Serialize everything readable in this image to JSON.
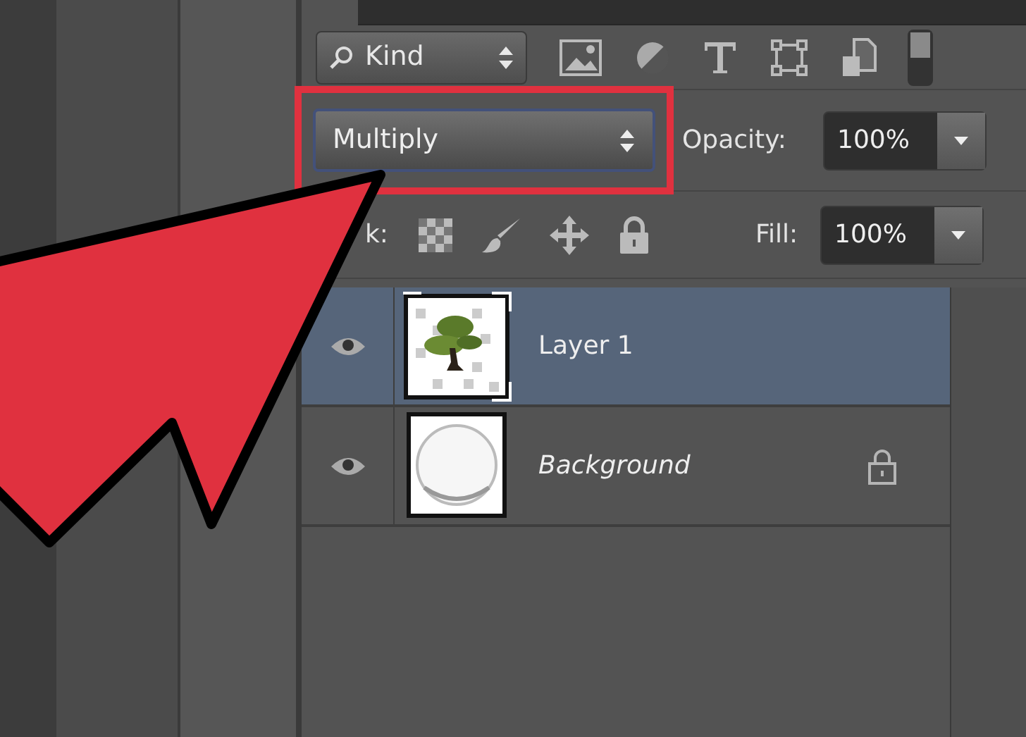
{
  "filter": {
    "label": "Kind"
  },
  "blend_mode": {
    "value": "Multiply",
    "highlighted": true
  },
  "opacity": {
    "label": "Opacity:",
    "value": "100%"
  },
  "lock": {
    "label": "k:"
  },
  "fill": {
    "label": "Fill:",
    "value": "100%"
  },
  "layers": [
    {
      "name": "Layer 1",
      "kind": "normal",
      "selected": true,
      "visible": true,
      "locked": false
    },
    {
      "name": "Background",
      "kind": "background",
      "selected": false,
      "visible": true,
      "locked": true
    }
  ],
  "annotation_arrow": true
}
